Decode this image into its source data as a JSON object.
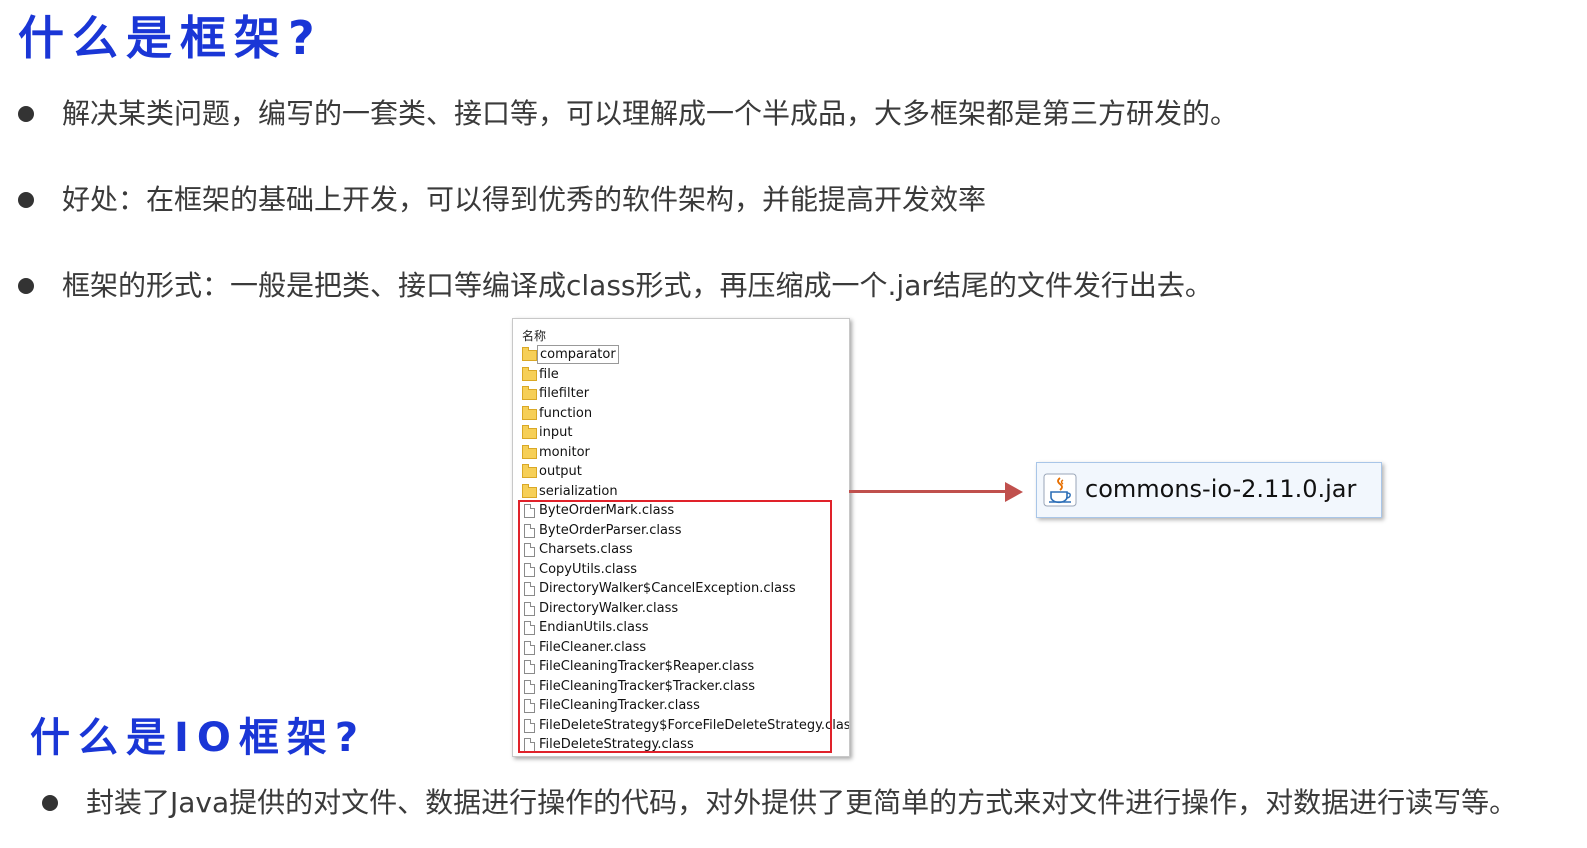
{
  "heading1": "什么是框架?",
  "heading2": "什么是IO框架?",
  "bullets": [
    "解决某类问题，编写的一套类、接口等，可以理解成一个半成品，大多框架都是第三方研发的。",
    "好处：在框架的基础上开发，可以得到优秀的软件架构，并能提高开发效率",
    "框架的形式：一般是把类、接口等编译成class形式，再压缩成一个.jar结尾的文件发行出去。"
  ],
  "io_bullet": "封装了Java提供的对文件、数据进行操作的代码，对外提供了更简单的方式来对文件进行操作，对数据进行读写等。",
  "explorer": {
    "column_header": "名称",
    "folders": [
      "comparator",
      "file",
      "filefilter",
      "function",
      "input",
      "monitor",
      "output",
      "serialization"
    ],
    "files": [
      "ByteOrderMark.class",
      "ByteOrderParser.class",
      "Charsets.class",
      "CopyUtils.class",
      "DirectoryWalker$CancelException.class",
      "DirectoryWalker.class",
      "EndianUtils.class",
      "FileCleaner.class",
      "FileCleaningTracker$Reaper.class",
      "FileCleaningTracker$Tracker.class",
      "FileCleaningTracker.class",
      "FileDeleteStrategy$ForceFileDeleteStrategy.class",
      "FileDeleteStrategy.class"
    ]
  },
  "jar": {
    "name": "commons-io-2.11.0.jar",
    "icon": "java-jar-icon"
  },
  "colors": {
    "heading": "#1a36d6",
    "highlight_box": "#e0222a",
    "arrow": "#c0504d"
  }
}
